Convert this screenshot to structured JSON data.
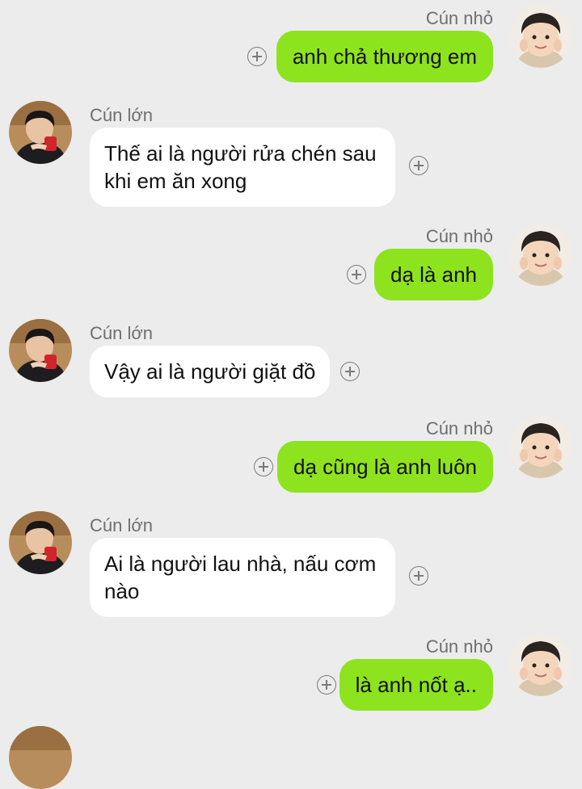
{
  "colors": {
    "background": "#ececec",
    "outgoing_bubble": "#8ee31f",
    "incoming_bubble": "#ffffff",
    "sender_name": "#6f6f6f"
  },
  "icons": {
    "reaction": "plus-circle-icon",
    "avatar": "profile-photo"
  },
  "users": {
    "me": "Cún nhỏ",
    "partner": "Cún lớn"
  },
  "messages": [
    {
      "sender": "Cún nhỏ",
      "side": "outgoing",
      "text": "anh chả thương em"
    },
    {
      "sender": "Cún lớn",
      "side": "incoming",
      "text": "Thế ai là người rửa chén sau khi em ăn xong"
    },
    {
      "sender": "Cún nhỏ",
      "side": "outgoing",
      "text": "dạ là anh"
    },
    {
      "sender": "Cún lớn",
      "side": "incoming",
      "text": "Vậy ai là người giặt đồ"
    },
    {
      "sender": "Cún nhỏ",
      "side": "outgoing",
      "text": "dạ cũng là anh luôn"
    },
    {
      "sender": "Cún lớn",
      "side": "incoming",
      "text": "Ai là người lau nhà, nấu cơm nào"
    },
    {
      "sender": "Cún nhỏ",
      "side": "outgoing",
      "text": "là anh nốt ạ.."
    }
  ]
}
